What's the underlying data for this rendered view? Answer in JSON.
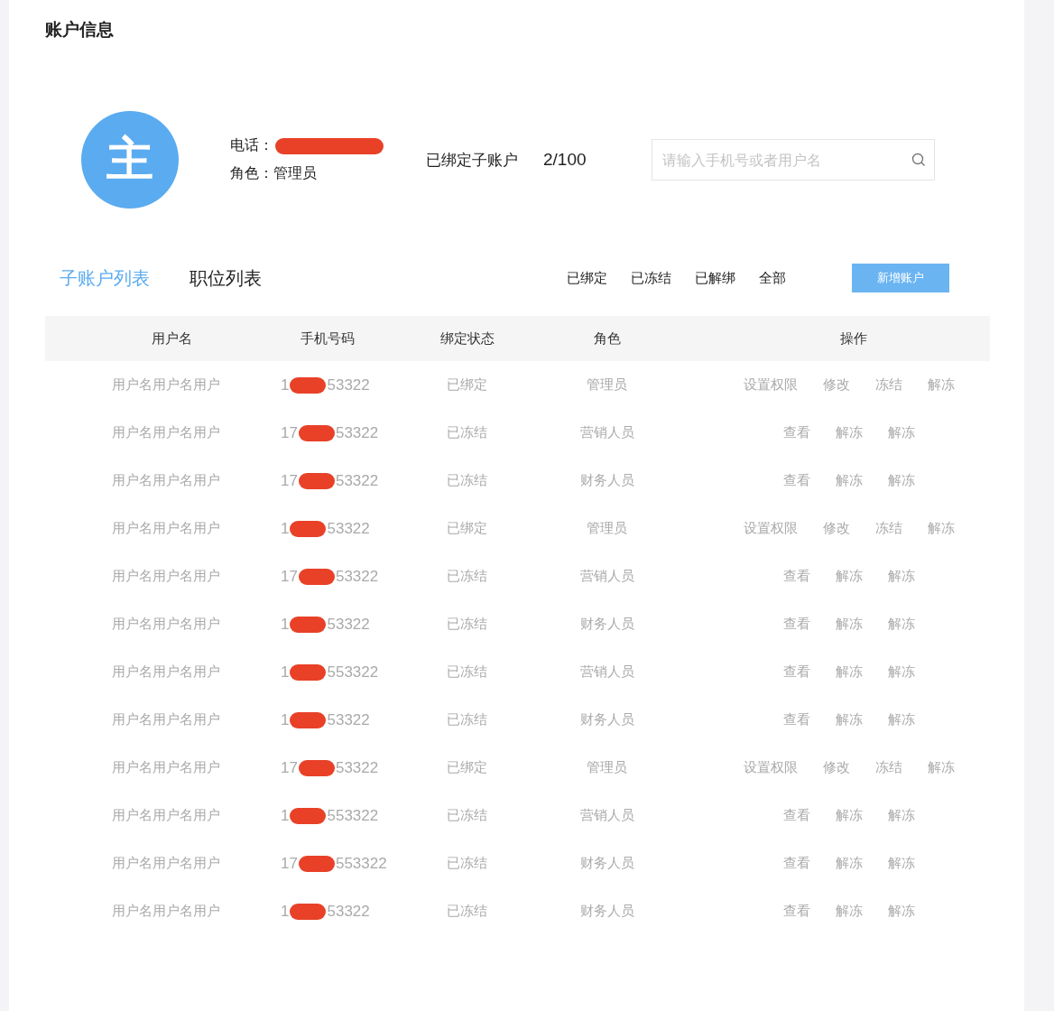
{
  "title": "账户信息",
  "account": {
    "avatar": "主",
    "phone_label": "电话：",
    "role_label": "角色：",
    "role": "管理员",
    "bound_label": "已绑定子账户",
    "bound_count": "2/100"
  },
  "search": {
    "placeholder": "请输入手机号或者用户名"
  },
  "tabs": [
    {
      "label": "子账户列表",
      "selected": true
    },
    {
      "label": "职位列表",
      "selected": false
    }
  ],
  "filters": [
    "已绑定",
    "已冻结",
    "已解绑",
    "全部"
  ],
  "add_button": "新增账户",
  "table": {
    "columns": [
      "用户名",
      "手机号码",
      "绑定状态",
      "角色",
      "操作"
    ],
    "rows": [
      {
        "name": "用户名用户名用户",
        "phone_prefix": "1",
        "phone_suffix": "53322",
        "status": "已绑定",
        "role": "管理员",
        "kind": "admin",
        "actions": [
          "设置权限",
          "修改",
          "冻结",
          "解冻"
        ]
      },
      {
        "name": "用户名用户名用户",
        "phone_prefix": "17",
        "phone_suffix": "53322",
        "status": "已冻结",
        "role": "营销人员",
        "kind": "member",
        "actions": [
          "查看",
          "解冻",
          "解冻"
        ]
      },
      {
        "name": "用户名用户名用户",
        "phone_prefix": "17",
        "phone_suffix": "53322",
        "status": "已冻结",
        "role": "财务人员",
        "kind": "member",
        "actions": [
          "查看",
          "解冻",
          "解冻"
        ]
      },
      {
        "name": "用户名用户名用户",
        "phone_prefix": "1",
        "phone_suffix": "53322",
        "status": "已绑定",
        "role": "管理员",
        "kind": "admin",
        "actions": [
          "设置权限",
          "修改",
          "冻结",
          "解冻"
        ]
      },
      {
        "name": "用户名用户名用户",
        "phone_prefix": "17",
        "phone_suffix": "53322",
        "status": "已冻结",
        "role": "营销人员",
        "kind": "member",
        "actions": [
          "查看",
          "解冻",
          "解冻"
        ]
      },
      {
        "name": "用户名用户名用户",
        "phone_prefix": "1",
        "phone_suffix": "53322",
        "status": "已冻结",
        "role": "财务人员",
        "kind": "member",
        "actions": [
          "查看",
          "解冻",
          "解冻"
        ]
      },
      {
        "name": "用户名用户名用户",
        "phone_prefix": "1",
        "phone_suffix": "553322",
        "status": "已冻结",
        "role": "营销人员",
        "kind": "member",
        "actions": [
          "查看",
          "解冻",
          "解冻"
        ]
      },
      {
        "name": "用户名用户名用户",
        "phone_prefix": "1",
        "phone_suffix": "53322",
        "status": "已冻结",
        "role": "财务人员",
        "kind": "member",
        "actions": [
          "查看",
          "解冻",
          "解冻"
        ]
      },
      {
        "name": "用户名用户名用户",
        "phone_prefix": "17",
        "phone_suffix": "53322",
        "status": "已绑定",
        "role": "管理员",
        "kind": "admin",
        "actions": [
          "设置权限",
          "修改",
          "冻结",
          "解冻"
        ]
      },
      {
        "name": "用户名用户名用户",
        "phone_prefix": "1",
        "phone_suffix": "553322",
        "status": "已冻结",
        "role": "营销人员",
        "kind": "member",
        "actions": [
          "查看",
          "解冻",
          "解冻"
        ]
      },
      {
        "name": "用户名用户名用户",
        "phone_prefix": "17",
        "phone_suffix": "553322",
        "status": "已冻结",
        "role": "财务人员",
        "kind": "member",
        "actions": [
          "查看",
          "解冻",
          "解冻"
        ]
      },
      {
        "name": "用户名用户名用户",
        "phone_prefix": "1",
        "phone_suffix": "53322",
        "status": "已冻结",
        "role": "财务人员",
        "kind": "member",
        "actions": [
          "查看",
          "解冻",
          "解冻"
        ]
      }
    ]
  }
}
